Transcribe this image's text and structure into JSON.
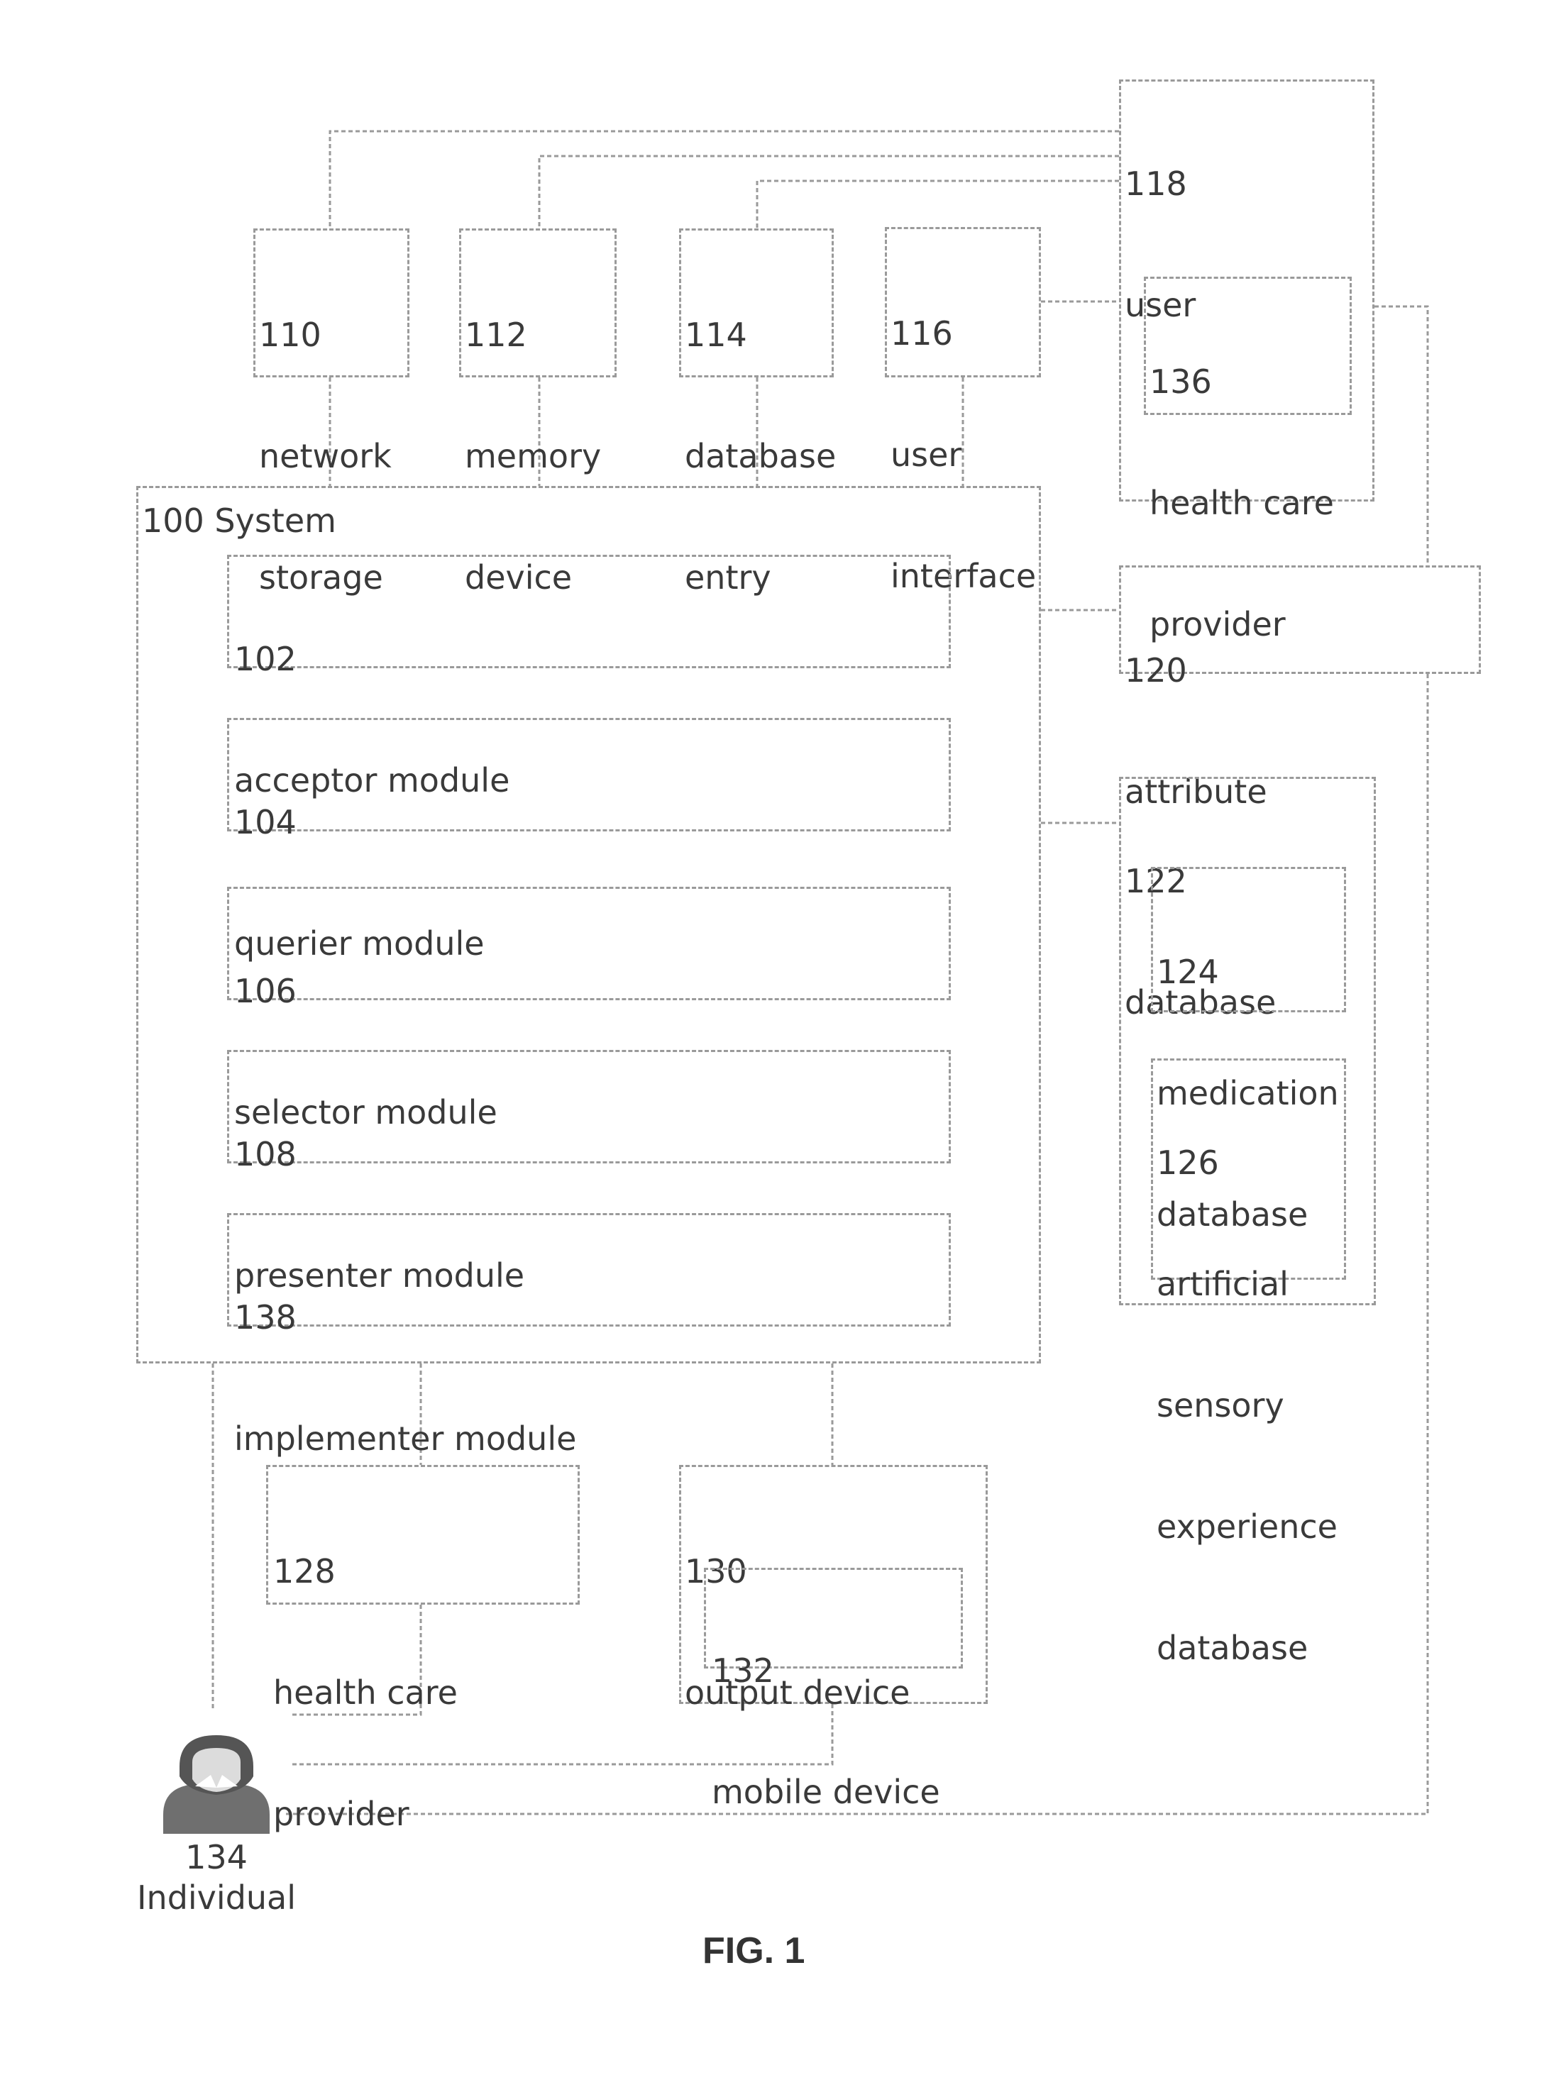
{
  "figure_label": "FIG. 1",
  "components": {
    "user": {
      "num": "118",
      "text": "user"
    },
    "health_care_provider_136": {
      "num": "136",
      "line1": "health care",
      "line2": "provider"
    },
    "network_storage": {
      "num": "110",
      "line1": "network",
      "line2": "storage"
    },
    "memory_device": {
      "num": "112",
      "line1": "memory",
      "line2": "device"
    },
    "database_entry": {
      "num": "114",
      "line1": "database",
      "line2": "entry"
    },
    "user_interface": {
      "num": "116",
      "line1": "user",
      "line2": "interface"
    },
    "system": {
      "label": "100 System"
    },
    "acceptor_module": {
      "num": "102",
      "text": "acceptor module"
    },
    "querier_module": {
      "num": "104",
      "text": "querier module"
    },
    "selector_module": {
      "num": "106",
      "text": "selector module"
    },
    "presenter_module": {
      "num": "108",
      "text": "presenter module"
    },
    "implementer_module": {
      "num": "138",
      "text": "implementer module"
    },
    "attribute": {
      "num": "120",
      "text": "attribute"
    },
    "database": {
      "num": "122",
      "text": "database"
    },
    "medication_database": {
      "num": "124",
      "line1": "medication",
      "line2": "database"
    },
    "artificial_sensory_database": {
      "num": "126",
      "line1": "artificial",
      "line2": "sensory",
      "line3": "experience",
      "line4": "database"
    },
    "health_care_provider_128": {
      "num": "128",
      "line1": "health care",
      "line2": "provider"
    },
    "output_device": {
      "num": "130",
      "text": "output device"
    },
    "mobile_device": {
      "num": "132",
      "text": "mobile device"
    },
    "individual": {
      "num": "134",
      "text": "Individual"
    }
  }
}
